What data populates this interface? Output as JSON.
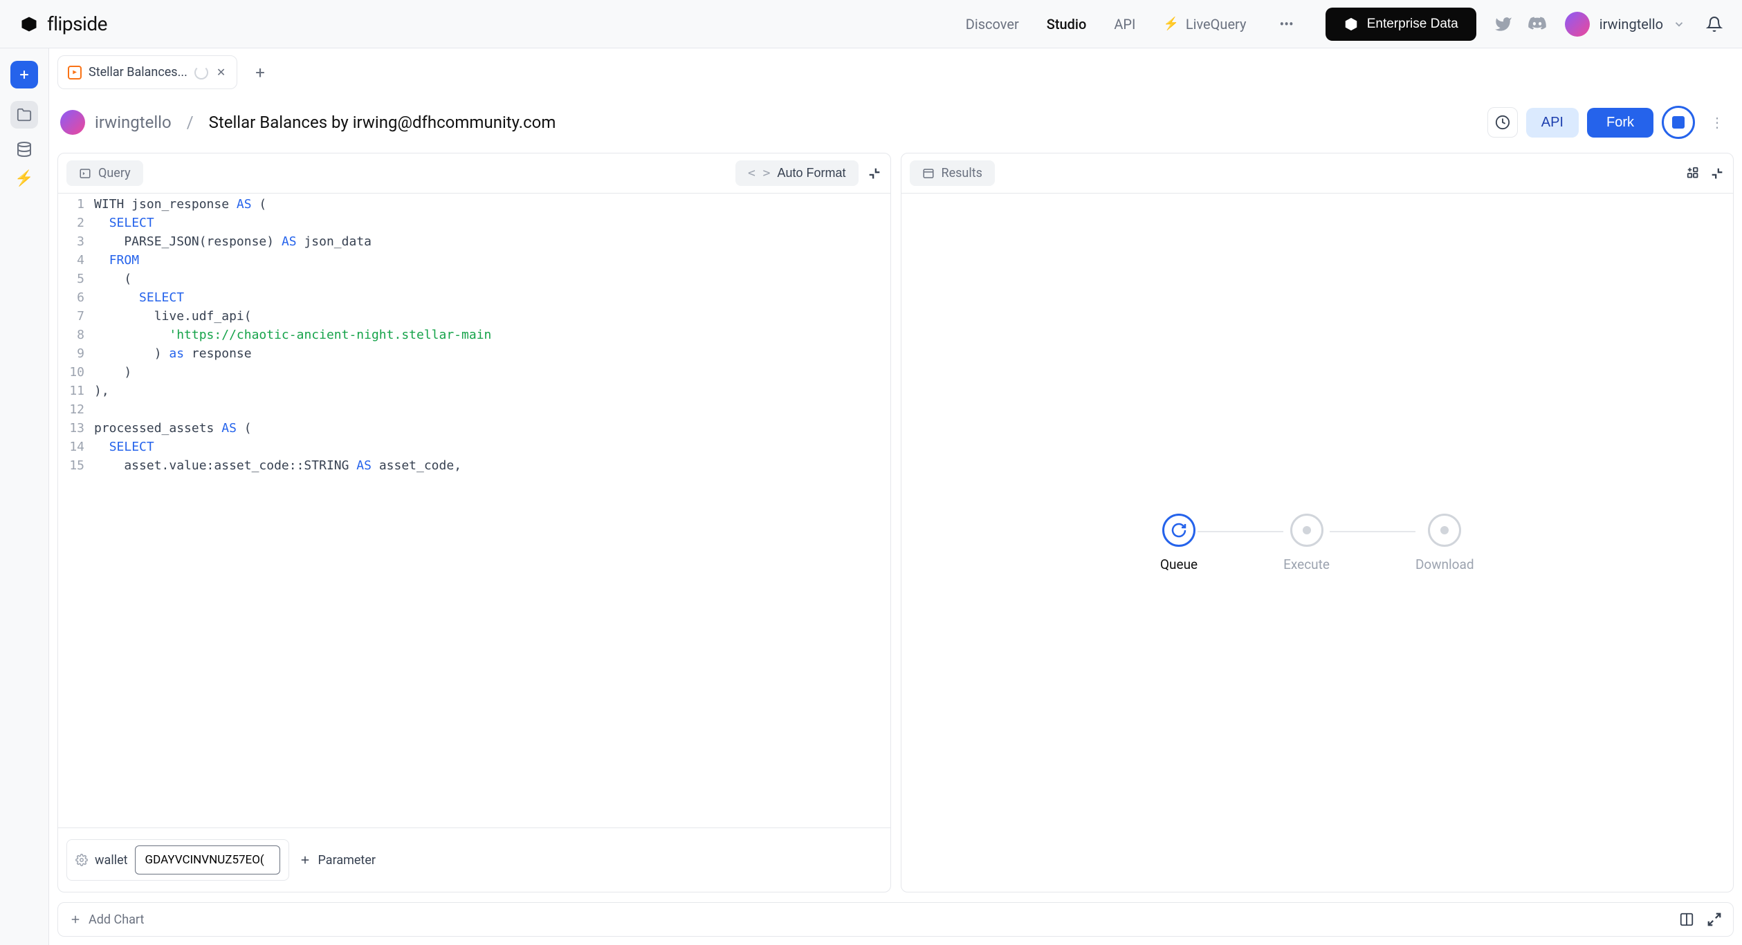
{
  "header": {
    "logo_text": "flipside",
    "nav": {
      "discover": "Discover",
      "studio": "Studio",
      "api": "API",
      "livequery": "LiveQuery"
    },
    "enterprise_button": "Enterprise Data",
    "username": "irwingtello"
  },
  "tabs": {
    "tab1_title": "Stellar Balances..."
  },
  "breadcrumb": {
    "owner": "irwingtello",
    "title": "Stellar Balances by irwing@dfhcommunity.com"
  },
  "actions": {
    "api": "API",
    "fork": "Fork"
  },
  "query_panel": {
    "tab_label": "Query",
    "autoformat": "Auto Format",
    "auto_icon": "< >"
  },
  "code": {
    "lines": [
      "1",
      "2",
      "3",
      "4",
      "5",
      "6",
      "7",
      "8",
      "9",
      "10",
      "11",
      "12",
      "13",
      "14",
      "15"
    ],
    "l1a": "WITH json_response ",
    "l1b": "AS",
    "l1c": " (",
    "l2a": "  ",
    "l2b": "SELECT",
    "l3": "    PARSE_JSON(response) ",
    "l3b": "AS",
    "l3c": " json_data",
    "l4a": "  ",
    "l4b": "FROM",
    "l5": "    (",
    "l6a": "      ",
    "l6b": "SELECT",
    "l7": "        live.udf_api(",
    "l8a": "          ",
    "l8b": "'https://chaotic-ancient-night.stellar-main",
    "l9a": "        ) ",
    "l9b": "as",
    "l9c": " response",
    "l10": "    )",
    "l11": "),",
    "l12": "",
    "l13a": "processed_assets ",
    "l13b": "AS",
    "l13c": " (",
    "l14a": "  ",
    "l14b": "SELECT",
    "l15a": "    asset.value:asset_code::STRING ",
    "l15b": "AS",
    "l15c": " asset_code,"
  },
  "params": {
    "label": "wallet",
    "value": "GDAYVCINVNUZ57EO(",
    "add_label": "Parameter"
  },
  "results_panel": {
    "tab_label": "Results",
    "steps": {
      "queue": "Queue",
      "execute": "Execute",
      "download": "Download"
    }
  },
  "bottom": {
    "add_chart": "Add Chart"
  }
}
